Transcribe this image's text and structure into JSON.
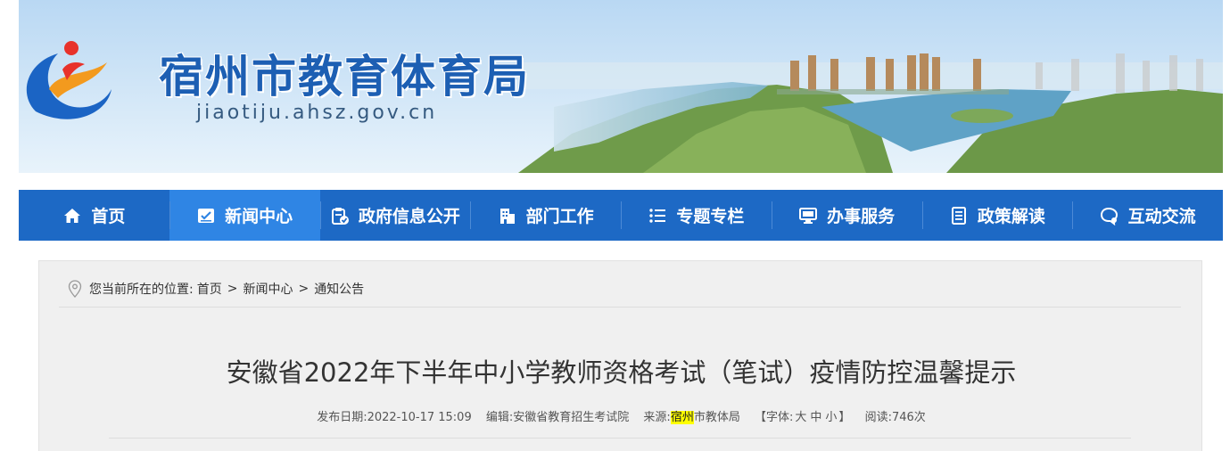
{
  "header": {
    "site_title": "宿州市教育体育局",
    "site_url": "jiaotiju.ahsz.gov.cn"
  },
  "nav": {
    "items": [
      {
        "label": "首页",
        "icon": "home-icon"
      },
      {
        "label": "新闻中心",
        "icon": "news-icon",
        "active": true
      },
      {
        "label": "政府信息公开",
        "icon": "clipboard-check-icon"
      },
      {
        "label": "部门工作",
        "icon": "building-icon"
      },
      {
        "label": "专题专栏",
        "icon": "list-icon"
      },
      {
        "label": "办事服务",
        "icon": "monitor-icon"
      },
      {
        "label": "政策解读",
        "icon": "document-icon"
      },
      {
        "label": "互动交流",
        "icon": "chat-icon"
      }
    ]
  },
  "breadcrumb": {
    "prefix": "您当前所在的位置:",
    "items": [
      "首页",
      "新闻中心",
      "通知公告"
    ],
    "separator": ">"
  },
  "article": {
    "title": "安徽省2022年下半年中小学教师资格考试（笔试）疫情防控温馨提示",
    "publish_label": "发布日期:",
    "publish_date": "2022-10-17 15:09",
    "editor_label": "编辑:",
    "editor": "安徽省教育招生考试院",
    "source_label": "来源:",
    "source_highlight": "宿州",
    "source_rest": "市教体局",
    "font_label_open": "【字体:",
    "font_large": "大",
    "font_medium": "中",
    "font_small": "小",
    "font_label_close": "】",
    "views_label": "阅读:",
    "views": "746次"
  },
  "colors": {
    "nav_bg": "#1d69c5",
    "nav_active": "#2f85e4",
    "title_blue": "#1d5fb3",
    "highlight": "#ffff00"
  }
}
